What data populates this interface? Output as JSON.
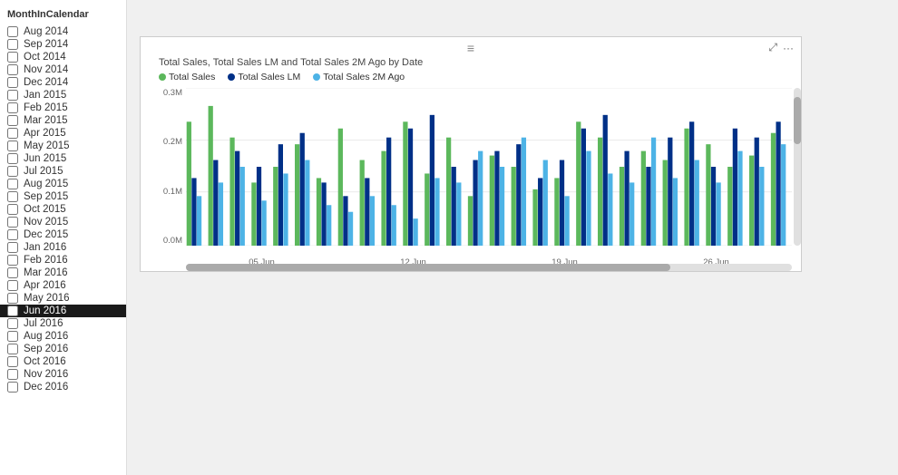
{
  "sidebar": {
    "header": "MonthInCalendar",
    "items": [
      {
        "label": "Aug 2014",
        "checked": false,
        "selected": false
      },
      {
        "label": "Sep 2014",
        "checked": false,
        "selected": false
      },
      {
        "label": "Oct 2014",
        "checked": false,
        "selected": false
      },
      {
        "label": "Nov 2014",
        "checked": false,
        "selected": false
      },
      {
        "label": "Dec 2014",
        "checked": false,
        "selected": false
      },
      {
        "label": "Jan 2015",
        "checked": false,
        "selected": false
      },
      {
        "label": "Feb 2015",
        "checked": false,
        "selected": false
      },
      {
        "label": "Mar 2015",
        "checked": false,
        "selected": false
      },
      {
        "label": "Apr 2015",
        "checked": false,
        "selected": false
      },
      {
        "label": "May 2015",
        "checked": false,
        "selected": false
      },
      {
        "label": "Jun 2015",
        "checked": false,
        "selected": false
      },
      {
        "label": "Jul 2015",
        "checked": false,
        "selected": false
      },
      {
        "label": "Aug 2015",
        "checked": false,
        "selected": false
      },
      {
        "label": "Sep 2015",
        "checked": false,
        "selected": false
      },
      {
        "label": "Oct 2015",
        "checked": false,
        "selected": false
      },
      {
        "label": "Nov 2015",
        "checked": false,
        "selected": false
      },
      {
        "label": "Dec 2015",
        "checked": false,
        "selected": false
      },
      {
        "label": "Jan 2016",
        "checked": false,
        "selected": false
      },
      {
        "label": "Feb 2016",
        "checked": false,
        "selected": false
      },
      {
        "label": "Mar 2016",
        "checked": false,
        "selected": false
      },
      {
        "label": "Apr 2016",
        "checked": false,
        "selected": false
      },
      {
        "label": "May 2016",
        "checked": false,
        "selected": false
      },
      {
        "label": "Jun 2016",
        "checked": false,
        "selected": true
      },
      {
        "label": "Jul 2016",
        "checked": false,
        "selected": false
      },
      {
        "label": "Aug 2016",
        "checked": false,
        "selected": false
      },
      {
        "label": "Sep 2016",
        "checked": false,
        "selected": false
      },
      {
        "label": "Oct 2016",
        "checked": false,
        "selected": false
      },
      {
        "label": "Nov 2016",
        "checked": false,
        "selected": false
      },
      {
        "label": "Dec 2016",
        "checked": false,
        "selected": false
      }
    ]
  },
  "chart": {
    "title": "Total Sales, Total Sales LM and Total Sales 2M Ago by Date",
    "legend": [
      {
        "label": "Total Sales",
        "color": "#5cb85c"
      },
      {
        "label": "Total Sales LM",
        "color": "#003087"
      },
      {
        "label": "Total Sales 2M Ago",
        "color": "#4db3e6"
      }
    ],
    "yAxis": [
      "0.3M",
      "0.2M",
      "0.1M",
      "0.0M"
    ],
    "xAxis": [
      "05 Jun",
      "12 Jun",
      "19 Jun",
      "26 Jun"
    ],
    "menuIcon": "≡",
    "expandIcon": "⤢",
    "moreIcon": "···",
    "bars": [
      {
        "green": 55,
        "blue": 30,
        "light": 22
      },
      {
        "green": 62,
        "blue": 38,
        "light": 28
      },
      {
        "green": 48,
        "blue": 42,
        "light": 35
      },
      {
        "green": 28,
        "blue": 35,
        "light": 20
      },
      {
        "green": 35,
        "blue": 45,
        "light": 32
      },
      {
        "green": 45,
        "blue": 50,
        "light": 38
      },
      {
        "green": 30,
        "blue": 28,
        "light": 18
      },
      {
        "green": 52,
        "blue": 22,
        "light": 15
      },
      {
        "green": 38,
        "blue": 30,
        "light": 22
      },
      {
        "green": 42,
        "blue": 48,
        "light": 18
      },
      {
        "green": 55,
        "blue": 52,
        "light": 12
      },
      {
        "green": 32,
        "blue": 58,
        "light": 30
      },
      {
        "green": 48,
        "blue": 35,
        "light": 28
      },
      {
        "green": 22,
        "blue": 38,
        "light": 42
      },
      {
        "green": 40,
        "blue": 42,
        "light": 35
      },
      {
        "green": 35,
        "blue": 45,
        "light": 48
      },
      {
        "green": 25,
        "blue": 30,
        "light": 38
      },
      {
        "green": 30,
        "blue": 38,
        "light": 22
      },
      {
        "green": 55,
        "blue": 52,
        "light": 42
      },
      {
        "green": 48,
        "blue": 58,
        "light": 32
      },
      {
        "green": 35,
        "blue": 42,
        "light": 28
      },
      {
        "green": 42,
        "blue": 35,
        "light": 48
      },
      {
        "green": 38,
        "blue": 48,
        "light": 30
      },
      {
        "green": 52,
        "blue": 55,
        "light": 38
      },
      {
        "green": 45,
        "blue": 35,
        "light": 28
      },
      {
        "green": 35,
        "blue": 52,
        "light": 42
      },
      {
        "green": 40,
        "blue": 48,
        "light": 35
      },
      {
        "green": 50,
        "blue": 55,
        "light": 45
      }
    ]
  }
}
